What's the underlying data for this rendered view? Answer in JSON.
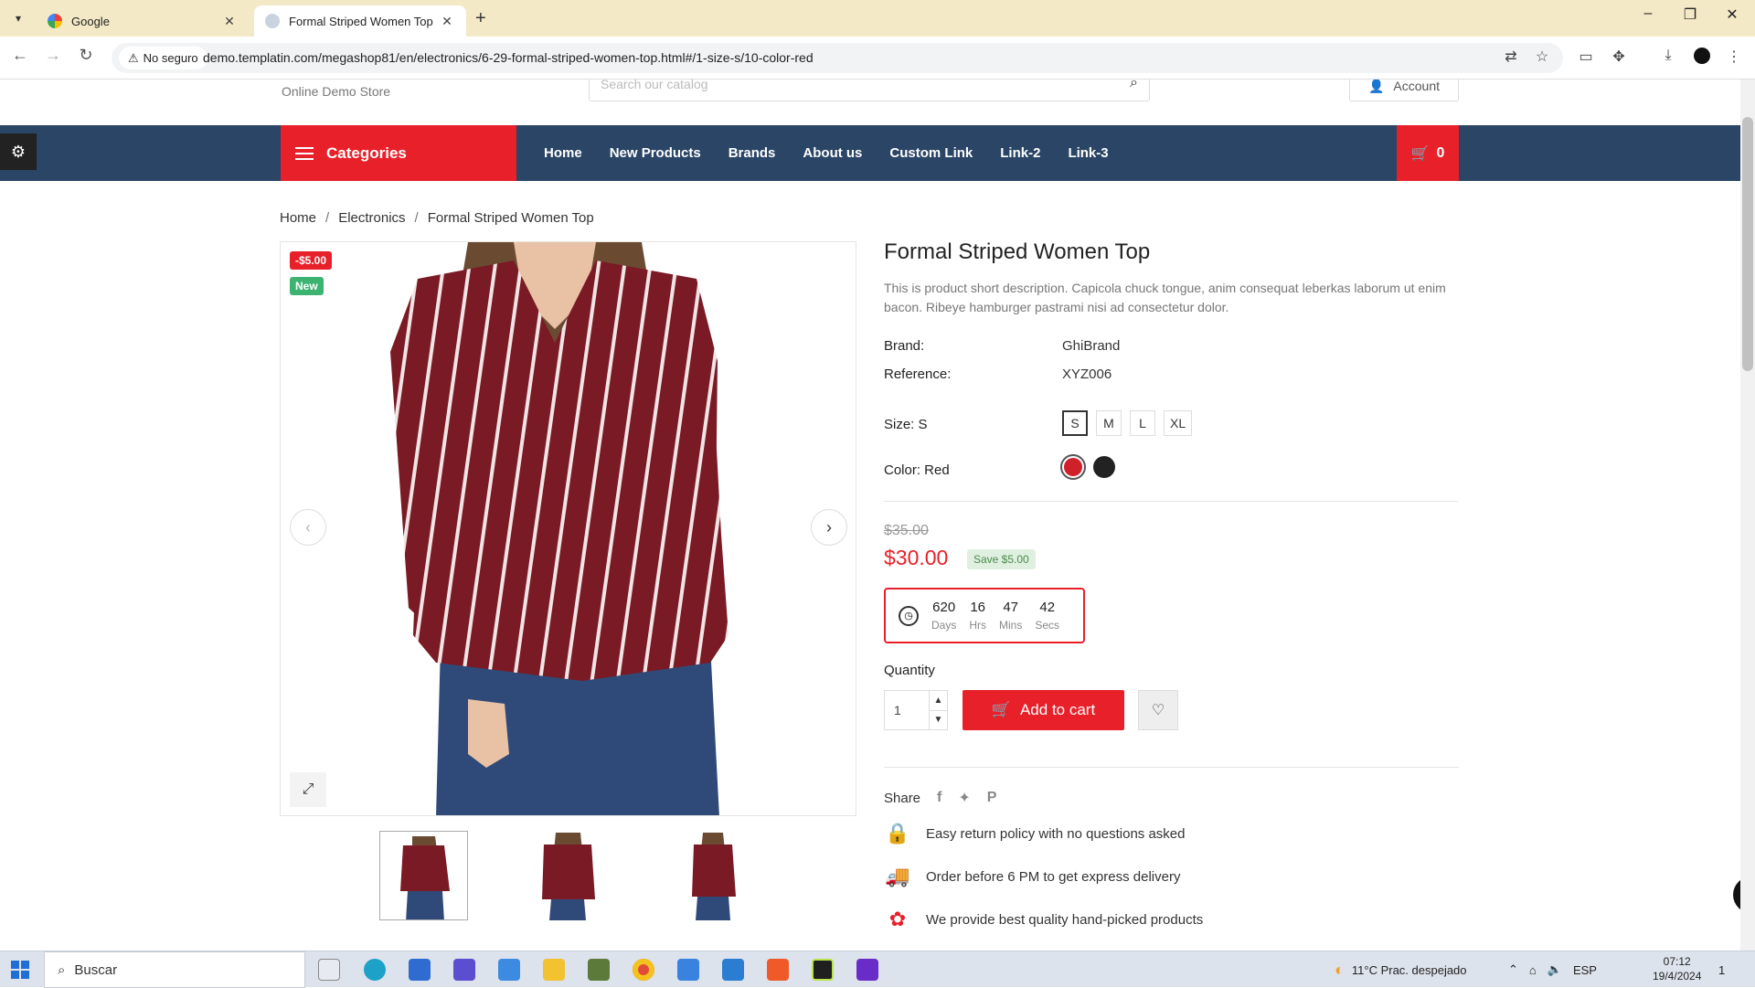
{
  "browser": {
    "tabs": [
      {
        "title": "Google",
        "active": false
      },
      {
        "title": "Formal Striped Women Top",
        "active": true
      }
    ],
    "security_label": "No seguro",
    "url": "demo.templatin.com/megashop81/en/electronics/6-29-formal-striped-women-top.html#/1-size-s/10-color-red"
  },
  "header": {
    "store_tagline": "Online Demo Store",
    "search_placeholder": "Search our catalog",
    "account_label": "Account"
  },
  "nav": {
    "categories_label": "Categories",
    "links": [
      "Home",
      "New Products",
      "Brands",
      "About us",
      "Custom Link",
      "Link-2",
      "Link-3"
    ],
    "cart_count": "0"
  },
  "breadcrumb": [
    "Home",
    "Electronics",
    "Formal Striped Women Top"
  ],
  "gallery": {
    "discount_badge": "-$5.00",
    "new_badge": "New",
    "thumbnail_count": 3
  },
  "product": {
    "title": "Formal Striped Women Top",
    "description": "This is product short description. Capicola chuck tongue, anim consequat leberkas laborum ut enim bacon. Ribeye hamburger pastrami nisi ad consectetur dolor.",
    "brand_label": "Brand:",
    "brand_value": "GhiBrand",
    "reference_label": "Reference:",
    "reference_value": "XYZ006",
    "size_label": "Size: S",
    "sizes": [
      "S",
      "M",
      "L",
      "XL"
    ],
    "selected_size": "S",
    "color_label": "Color: Red",
    "colors": [
      "#d0202a",
      "#222222"
    ],
    "old_price": "$35.00",
    "price": "$30.00",
    "save_label": "Save $5.00",
    "countdown": {
      "days": "620",
      "days_label": "Days",
      "hrs": "16",
      "hrs_label": "Hrs",
      "mins": "47",
      "mins_label": "Mins",
      "secs": "42",
      "secs_label": "Secs"
    },
    "quantity_label": "Quantity",
    "quantity_value": "1",
    "add_to_cart_label": "Add to cart",
    "share_label": "Share",
    "features": [
      "Easy return policy with no questions asked",
      "Order before 6 PM to get express delivery",
      "We provide best quality hand-picked products"
    ]
  },
  "taskbar": {
    "search_label": "Buscar",
    "weather": "11°C  Prac. despejado",
    "lang": "ESP",
    "time": "07:12",
    "date": "19/4/2024",
    "notif_count": "1"
  },
  "colors": {
    "accent": "#e8202a",
    "nav_bg": "#2a4565",
    "shirt": "#7a1a25"
  }
}
